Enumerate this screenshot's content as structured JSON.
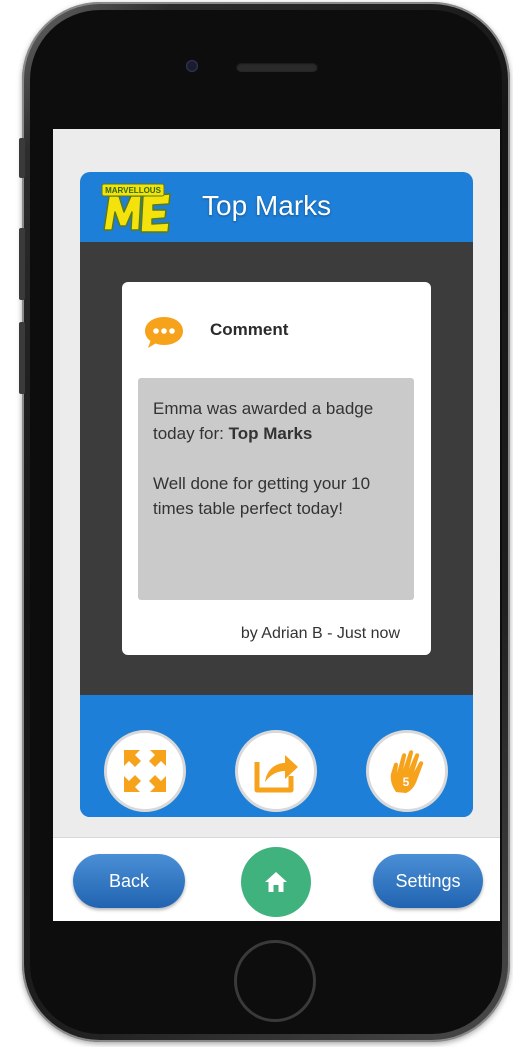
{
  "app": {
    "brand_text": "MARVELLOUS ME",
    "title": "Top Marks"
  },
  "note": {
    "type_label": "Comment",
    "message_lines": [
      "Emma was awarded a badge today for: ",
      "Top Marks",
      "Well done for getting your 10 times table perfect today!"
    ],
    "byline": "by Adrian B - Just now"
  },
  "actions": [
    {
      "icon": "expand-icon"
    },
    {
      "icon": "share-icon"
    },
    {
      "icon": "high-five-icon"
    }
  ],
  "nav": {
    "back_label": "Back",
    "home_icon": "home-icon",
    "settings_label": "Settings"
  },
  "colors": {
    "accent_blue": "#1d7fd8",
    "dark_panel": "#3c3c3c",
    "orange": "#f7a21b",
    "home_green": "#40b27e",
    "logo_yellow": "#f4e20c"
  }
}
